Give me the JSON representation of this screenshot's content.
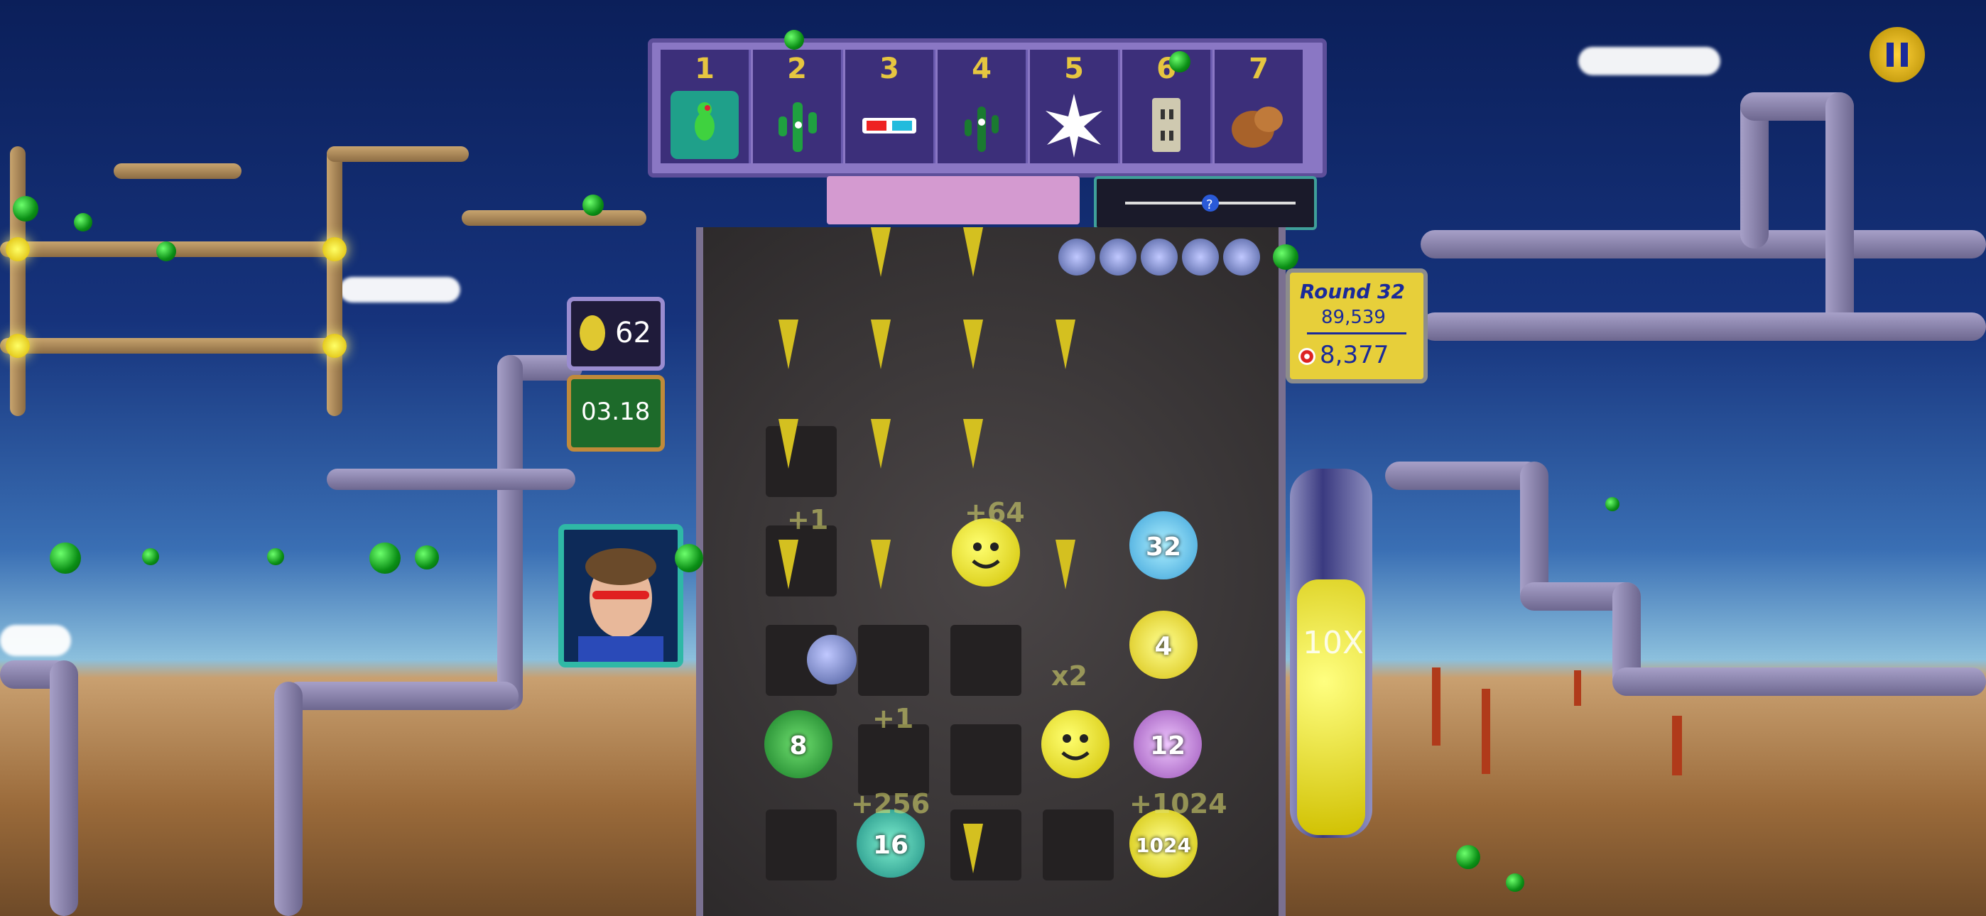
{
  "shop": {
    "slots": [
      {
        "number": "1",
        "icon": "green-bird-icon"
      },
      {
        "number": "2",
        "icon": "cactus-icon"
      },
      {
        "number": "3",
        "icon": "3d-glasses-icon"
      },
      {
        "number": "4",
        "icon": "cactus-sparkle-icon"
      },
      {
        "number": "5",
        "icon": "starburst-icon"
      },
      {
        "number": "6",
        "icon": "outlet-icon"
      },
      {
        "number": "7",
        "icon": "brown-blob-icon"
      }
    ]
  },
  "hud": {
    "coins": "62",
    "timer": "03.18",
    "round_label": "Round 32",
    "score": "89,539",
    "target": "8,377",
    "multiplier": "10X"
  },
  "board": {
    "tiles": [
      {
        "label": "32",
        "color": "#7fd0ff"
      },
      {
        "label": "4",
        "color": "#f3ef2a"
      },
      {
        "label": "8",
        "color": "#25b03a"
      },
      {
        "label": "12",
        "color": "#c07ad0"
      },
      {
        "label": "16",
        "color": "#2aa0a0"
      },
      {
        "label": "1024",
        "color": "#f0e830"
      }
    ],
    "floating_text": [
      "+1",
      "+64",
      "+1",
      "+256",
      "+1024",
      "x2"
    ]
  },
  "colors": {
    "sky_top": "#0b1f5a",
    "pipe": "#8f89b5",
    "accent_yellow": "#e7cf3a"
  }
}
